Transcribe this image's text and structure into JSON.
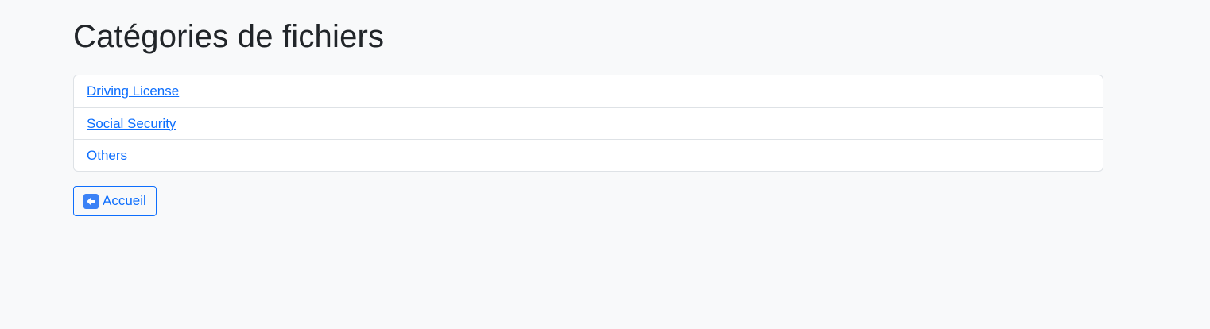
{
  "page": {
    "title": "Catégories de fichiers"
  },
  "categories": [
    {
      "label": "Driving License"
    },
    {
      "label": "Social Security"
    },
    {
      "label": "Others"
    }
  ],
  "back_button": {
    "label": "Accueil",
    "icon": "left-arrow-emoji-icon"
  },
  "colors": {
    "background": "#f8f9fa",
    "link": "#0d6efd",
    "border": "#dee2e6",
    "text": "#212529"
  }
}
